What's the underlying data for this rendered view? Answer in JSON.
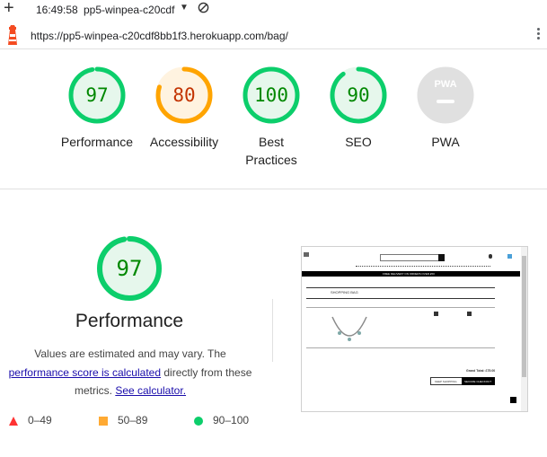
{
  "browser": {
    "time": "16:49:58",
    "tab_title": "pp5-winpea-c20cdf",
    "url": "https://pp5-winpea-c20cdf8bb1f3.herokuapp.com/bag/"
  },
  "gauges": [
    {
      "score": "97",
      "label_line1": "Performance",
      "label_line2": "",
      "color": "#0cce6b",
      "fill": "#e6f7ec",
      "text_color": "#008800",
      "fraction": 0.97
    },
    {
      "score": "80",
      "label_line1": "Accessibility",
      "label_line2": "",
      "color": "#ffa400",
      "fill": "#fff3e0",
      "text_color": "#c33300",
      "fraction": 0.8
    },
    {
      "score": "100",
      "label_line1": "Best",
      "label_line2": "Practices",
      "color": "#0cce6b",
      "fill": "#e6f7ec",
      "text_color": "#008800",
      "fraction": 1.0
    },
    {
      "score": "90",
      "label_line1": "SEO",
      "label_line2": "",
      "color": "#0cce6b",
      "fill": "#e6f7ec",
      "text_color": "#008800",
      "fraction": 0.9
    },
    {
      "score": "PWA",
      "label_line1": "PWA",
      "label_line2": "",
      "color": "#e0e0e0",
      "fill": "#e0e0e0",
      "text_color": "#ffffff",
      "fraction": 0
    }
  ],
  "performance": {
    "score": "97",
    "fraction": 0.97,
    "title": "Performance",
    "note_before": "Values are estimated and may vary. The",
    "link1": "performance score is calculated",
    "note_mid": "directly from these",
    "note_metrics": "metrics.",
    "link2": "See calculator."
  },
  "legend": {
    "fail": "0–49",
    "average": "50–89",
    "pass": "90–100"
  },
  "thumbnail": {
    "banner": "FREE DELIVERY ON ORDERS OVER £50",
    "heading": "SHOPPING BAG",
    "keep_shopping": "KEEP SHOPPING",
    "checkout": "SECURE CHECKOUT",
    "grand_total": "Grand Total: £75.00"
  }
}
